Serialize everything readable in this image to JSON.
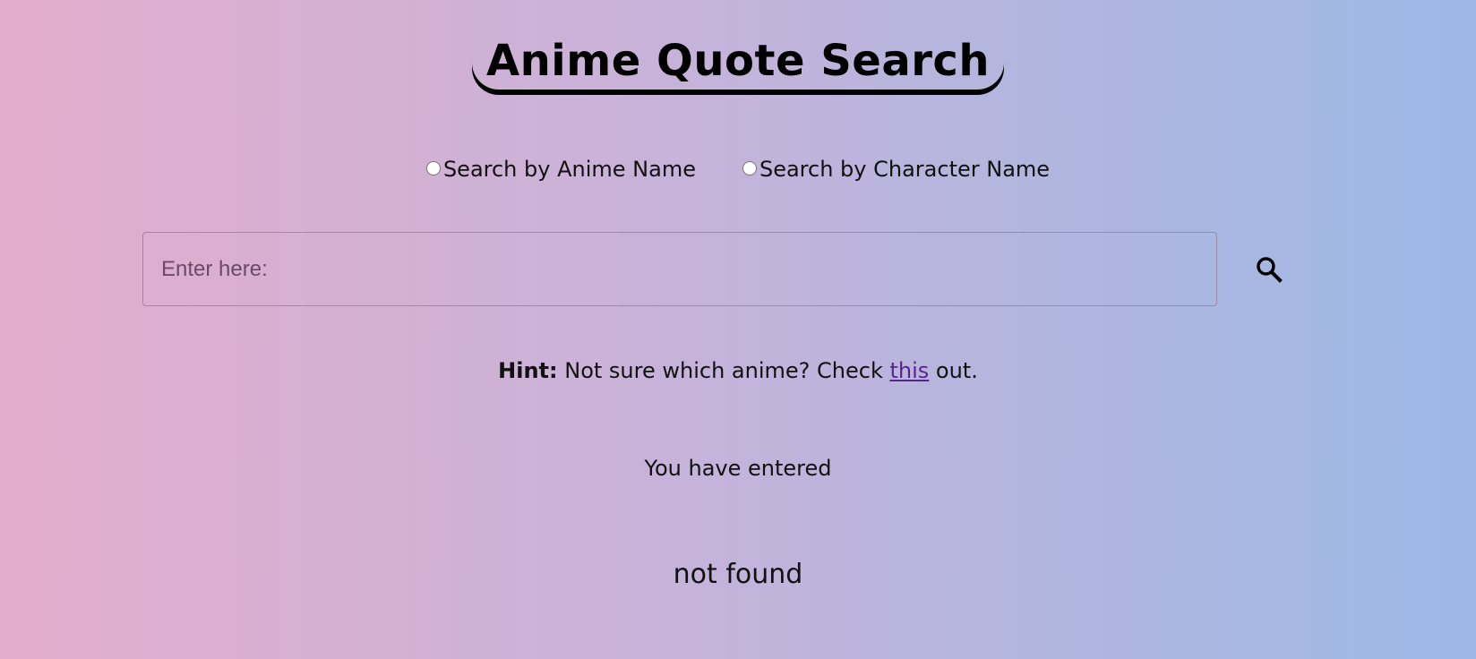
{
  "header": {
    "title": "Anime Quote Search"
  },
  "search_mode": {
    "options": [
      {
        "label": "Search by Anime Name",
        "checked": false
      },
      {
        "label": "Search by Character Name",
        "checked": false
      }
    ]
  },
  "search": {
    "value": "",
    "placeholder": "Enter here:",
    "button_icon": "search-icon"
  },
  "hint": {
    "label": "Hint:",
    "text_before": " Not sure which anime? Check ",
    "link_text": "this",
    "text_after": " out."
  },
  "status": {
    "entered_text": "You have entered",
    "result_text": "not found"
  },
  "colors": {
    "gradient_start": "#e3adcc",
    "gradient_end": "#9db8e6",
    "link": "#5a2490"
  }
}
